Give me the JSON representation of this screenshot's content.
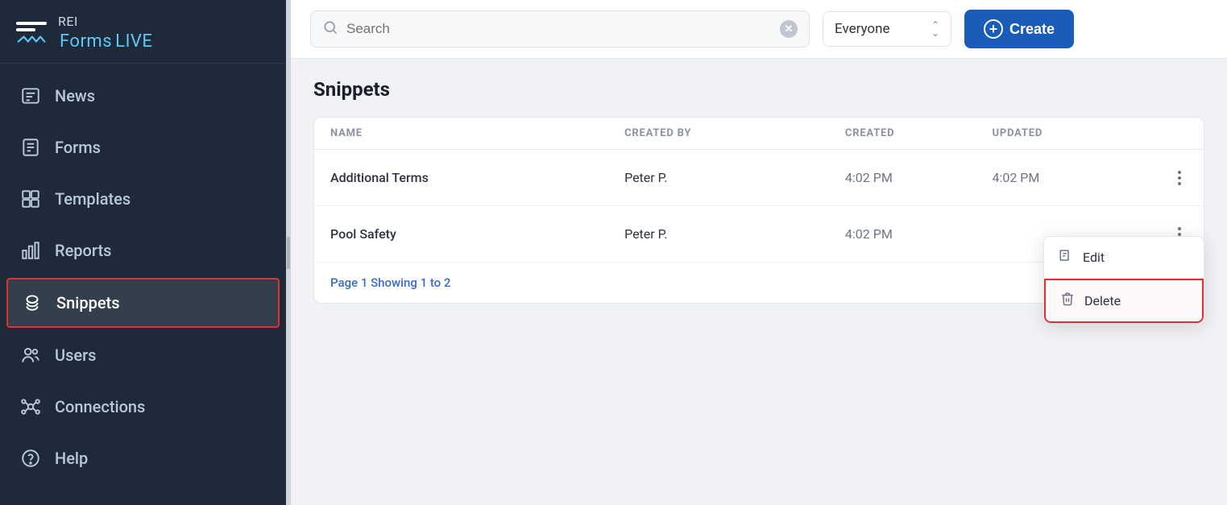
{
  "sidebar": {
    "logo": {
      "top": "REI",
      "bottom": "Forms",
      "live": "LIVE"
    },
    "items": [
      {
        "id": "news",
        "label": "News",
        "icon": "news-icon"
      },
      {
        "id": "forms",
        "label": "Forms",
        "icon": "forms-icon"
      },
      {
        "id": "templates",
        "label": "Templates",
        "icon": "templates-icon"
      },
      {
        "id": "reports",
        "label": "Reports",
        "icon": "reports-icon"
      },
      {
        "id": "snippets",
        "label": "Snippets",
        "icon": "snippets-icon",
        "active": true
      },
      {
        "id": "users",
        "label": "Users",
        "icon": "users-icon"
      },
      {
        "id": "connections",
        "label": "Connections",
        "icon": "connections-icon"
      },
      {
        "id": "help",
        "label": "Help",
        "icon": "help-icon"
      }
    ]
  },
  "topbar": {
    "search_placeholder": "Search",
    "filter_value": "Everyone",
    "create_label": "Create"
  },
  "main": {
    "title": "Snippets",
    "table": {
      "columns": [
        "NAME",
        "CREATED BY",
        "CREATED",
        "UPDATED",
        ""
      ],
      "rows": [
        {
          "name": "Additional Terms",
          "created_by": "Peter P.",
          "created": "4:02 PM",
          "updated": "4:02 PM"
        },
        {
          "name": "Pool Safety",
          "created_by": "Peter P.",
          "created": "4:02 PM",
          "updated": ""
        }
      ],
      "pagination": "Page 1 Showing 1 to 2"
    }
  },
  "context_menu": {
    "edit_label": "Edit",
    "delete_label": "Delete"
  }
}
